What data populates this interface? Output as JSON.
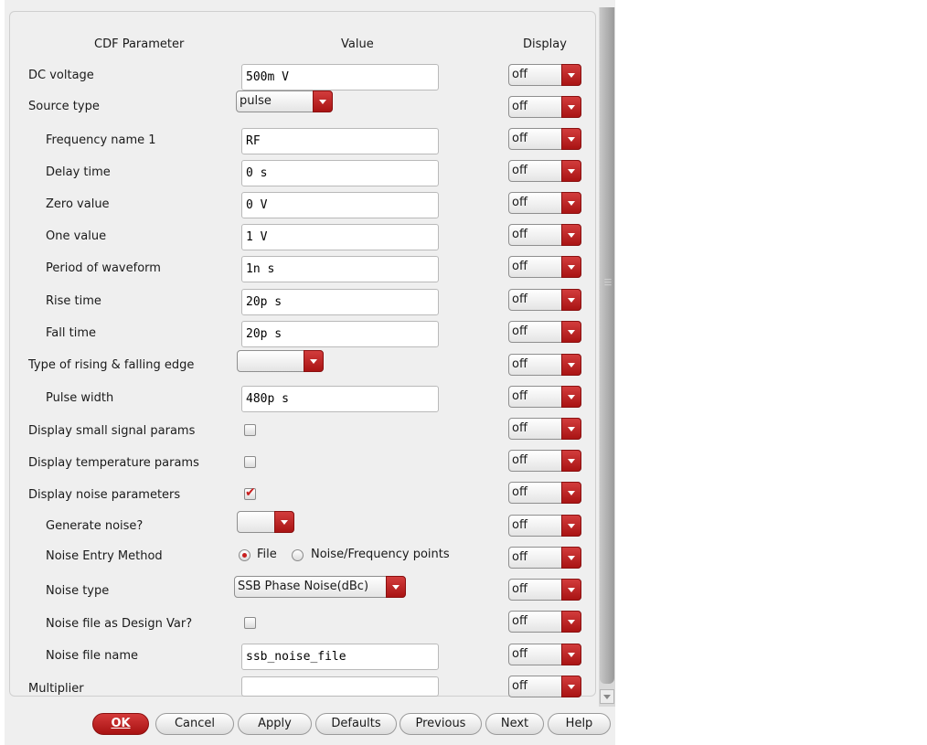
{
  "header": {
    "param": "CDF Parameter",
    "value": "Value",
    "display": "Display"
  },
  "rows": [
    {
      "label": "DC voltage",
      "type": "field",
      "value": "500m V",
      "display": "off"
    },
    {
      "label": "Source type",
      "type": "combo",
      "value": "pulse",
      "display": "off"
    },
    {
      "label": "Frequency name 1",
      "type": "field",
      "value": "RF",
      "display": "off"
    },
    {
      "label": "Delay time",
      "type": "field",
      "value": "0 s",
      "display": "off"
    },
    {
      "label": "Zero value",
      "type": "field",
      "value": "0 V",
      "display": "off"
    },
    {
      "label": "One value",
      "type": "field",
      "value": "1 V",
      "display": "off"
    },
    {
      "label": "Period of waveform",
      "type": "field",
      "value": "1n s",
      "display": "off"
    },
    {
      "label": "Rise time",
      "type": "field",
      "value": "20p s",
      "display": "off"
    },
    {
      "label": "Fall time",
      "type": "field",
      "value": "20p s",
      "display": "off"
    },
    {
      "label": "Type of rising & falling edge",
      "type": "combo",
      "value": "",
      "display": "off"
    },
    {
      "label": "Pulse width",
      "type": "field",
      "value": "480p s",
      "display": "off"
    },
    {
      "label": "Display small signal params",
      "type": "checkbox",
      "checked": false,
      "display": "off"
    },
    {
      "label": "Display temperature params",
      "type": "checkbox",
      "checked": false,
      "display": "off"
    },
    {
      "label": "Display noise parameters",
      "type": "checkbox",
      "checked": true,
      "display": "off"
    },
    {
      "label": "Generate noise?",
      "type": "combo",
      "value": "",
      "display": "off"
    },
    {
      "label": "Noise Entry Method",
      "type": "radio",
      "options": [
        "File",
        "Noise/Frequency points"
      ],
      "selected": "File",
      "display": "off"
    },
    {
      "label": "Noise type",
      "type": "combo",
      "value": "SSB Phase Noise(dBc)",
      "display": "off"
    },
    {
      "label": "Noise file as Design Var?",
      "type": "checkbox",
      "checked": false,
      "display": "off"
    },
    {
      "label": "Noise file name",
      "type": "field",
      "value": "ssb_noise_file",
      "display": "off"
    },
    {
      "label": "Multiplier",
      "type": "field",
      "value": "",
      "display": "off"
    }
  ],
  "buttons": {
    "ok": "OK",
    "cancel": "Cancel",
    "apply": "Apply",
    "defaults": "Defaults",
    "previous": "Previous",
    "next": "Next",
    "help": "Help"
  },
  "colors": {
    "accent": "#b81a1a",
    "panel": "#efefef"
  }
}
